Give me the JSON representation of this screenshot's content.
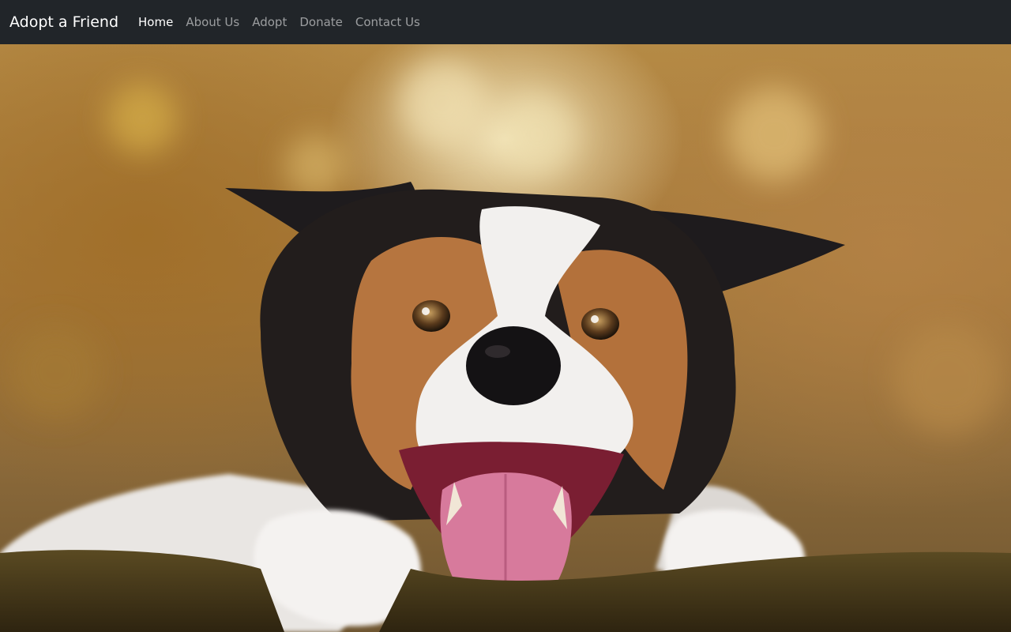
{
  "navbar": {
    "brand": "Adopt a Friend",
    "links": [
      {
        "label": "Home",
        "active": true
      },
      {
        "label": "About Us",
        "active": false
      },
      {
        "label": "Adopt",
        "active": false
      },
      {
        "label": "Donate",
        "active": false
      },
      {
        "label": "Contact Us",
        "active": false
      }
    ]
  },
  "hero": {
    "image": "happy-border-collie-photo"
  },
  "colors": {
    "navbar_bg": "#212529",
    "nav_active": "#ffffff",
    "nav_inactive": "rgba(255,255,255,0.55)"
  }
}
